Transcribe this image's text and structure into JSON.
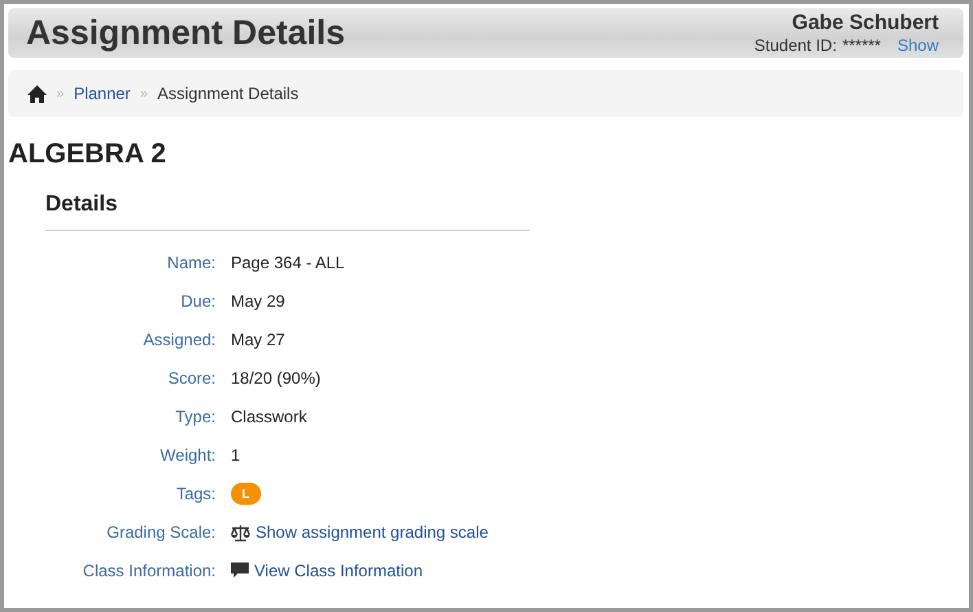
{
  "header": {
    "title": "Assignment Details",
    "student_name": "Gabe Schubert",
    "student_id_label": "Student ID:",
    "student_id_value": "******",
    "show_link": "Show"
  },
  "breadcrumb": [
    {
      "separator": "»",
      "label": "Planner",
      "kind": "link"
    },
    {
      "separator": "»",
      "label": "Assignment Details",
      "kind": "current"
    }
  ],
  "course_title": "ALGEBRA 2",
  "details": {
    "heading": "Details",
    "rows": [
      {
        "label": "Name:",
        "kind": "text",
        "value": "Page 364 - ALL"
      },
      {
        "label": "Due:",
        "kind": "text",
        "value": "May 29"
      },
      {
        "label": "Assigned:",
        "kind": "text",
        "value": "May 27"
      },
      {
        "label": "Score:",
        "kind": "text",
        "value": "18/20 (90%)"
      },
      {
        "label": "Type:",
        "kind": "text",
        "value": "Classwork"
      },
      {
        "label": "Weight:",
        "kind": "text",
        "value": "1"
      },
      {
        "label": "Tags:",
        "kind": "tags",
        "tags": [
          "L"
        ]
      },
      {
        "label": "Grading Scale:",
        "kind": "scale_link",
        "value": "Show assignment grading scale"
      },
      {
        "label": "Class Information:",
        "kind": "info_link",
        "value": "View Class Information"
      }
    ]
  }
}
